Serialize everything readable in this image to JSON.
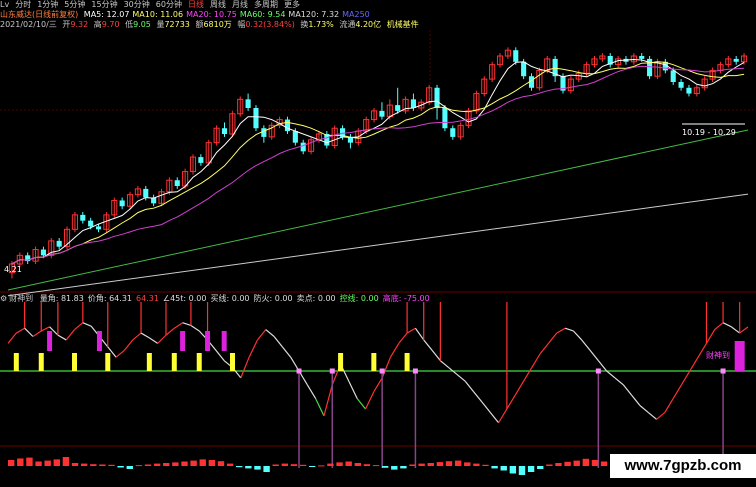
{
  "toolbar": {
    "items": [
      "Lv",
      "分时",
      "1分钟",
      "5分钟",
      "15分钟",
      "30分钟",
      "60分钟",
      "日线",
      "周线",
      "月线",
      "多周期",
      "更多"
    ],
    "active_index": 7
  },
  "info": {
    "title": "山东威达(日线前复权)",
    "ma": [
      {
        "label": "MA5",
        "value": "12.07",
        "color": "#ffffff"
      },
      {
        "label": "MA10",
        "value": "11.06",
        "color": "#ffff66"
      },
      {
        "label": "MA20",
        "value": "10.75",
        "color": "#ff44ff"
      },
      {
        "label": "MA60",
        "value": "9.54",
        "color": "#66ff66"
      },
      {
        "label": "MA120",
        "value": "7.32",
        "color": "#dddddd"
      },
      {
        "label": "MA250",
        "value": "",
        "color": "#6666ff"
      }
    ],
    "date": "2021/02/10/三",
    "open": {
      "label": "开",
      "value": "9.32"
    },
    "high": {
      "label": "高",
      "value": "9.70"
    },
    "low": {
      "label": "低",
      "value": "9.05"
    },
    "volume": {
      "label": "量",
      "value": "72733"
    },
    "amount": {
      "label": "额",
      "value": "6810万"
    },
    "change": {
      "label": "幅",
      "value": "0.32(3.84%)"
    },
    "turnover": {
      "label": "换",
      "value": "1.73%"
    },
    "float": {
      "label": "流通",
      "value": "4.20亿"
    },
    "sector": "机械基件"
  },
  "indicator": {
    "name": "财神到",
    "fields": [
      {
        "label": "量角",
        "value": "81.83",
        "color": "#dddddd"
      },
      {
        "label": "价角",
        "value": "64.31",
        "color": "#dddddd"
      },
      {
        "label": "",
        "value": "64.31",
        "color": "#ff4040"
      },
      {
        "label": "∠45t",
        "value": "0.00",
        "color": "#dddddd"
      },
      {
        "label": "买线",
        "value": "0.00",
        "color": "#dddddd"
      },
      {
        "label": "防火",
        "value": "0.00",
        "color": "#dddddd"
      },
      {
        "label": "卖点",
        "value": "0.00",
        "color": "#dddddd"
      },
      {
        "label": "控线",
        "value": "0.00",
        "color": "#66ff66"
      },
      {
        "label": "高底",
        "value": "-75.00",
        "color": "#ff44ff"
      }
    ]
  },
  "annotations": {
    "low_price": "4.21",
    "range_label": "10.19 - 10.29",
    "signal_label": "财神到"
  },
  "watermark": "www.7gpzb.com",
  "colors": {
    "up": "#ff3232",
    "down": "#54ffff",
    "ma5": "#ffffff",
    "ma10": "#ffff66",
    "ma20": "#d040d0",
    "ma60": "#44bb44",
    "ma120": "#cccccc"
  },
  "chart_data": [
    {
      "type": "candlestick",
      "title": "",
      "ylim": [
        4.0,
        13.0
      ],
      "candles": [
        [
          4.6,
          4.9,
          4.4,
          5.0
        ],
        [
          4.9,
          5.2,
          4.8,
          5.3
        ],
        [
          5.2,
          5.0,
          4.9,
          5.3
        ],
        [
          5.0,
          5.4,
          4.9,
          5.5
        ],
        [
          5.4,
          5.2,
          5.1,
          5.5
        ],
        [
          5.2,
          5.7,
          5.1,
          5.8
        ],
        [
          5.7,
          5.5,
          5.4,
          5.8
        ],
        [
          5.5,
          6.1,
          5.4,
          6.2
        ],
        [
          6.1,
          6.6,
          6.0,
          6.7
        ],
        [
          6.6,
          6.4,
          6.3,
          6.7
        ],
        [
          6.4,
          6.2,
          6.1,
          6.5
        ],
        [
          6.2,
          6.1,
          6.0,
          6.3
        ],
        [
          6.1,
          6.6,
          6.0,
          6.7
        ],
        [
          6.6,
          7.1,
          6.5,
          7.2
        ],
        [
          7.1,
          6.9,
          6.8,
          7.2
        ],
        [
          6.9,
          7.3,
          6.8,
          7.4
        ],
        [
          7.3,
          7.5,
          7.2,
          7.6
        ],
        [
          7.5,
          7.2,
          7.1,
          7.6
        ],
        [
          7.2,
          7.0,
          6.9,
          7.3
        ],
        [
          7.0,
          7.4,
          6.9,
          7.5
        ],
        [
          7.4,
          7.8,
          7.3,
          7.9
        ],
        [
          7.8,
          7.6,
          7.5,
          7.9
        ],
        [
          7.6,
          8.1,
          7.5,
          8.2
        ],
        [
          8.1,
          8.6,
          8.0,
          8.7
        ],
        [
          8.6,
          8.4,
          8.3,
          8.7
        ],
        [
          8.4,
          9.1,
          8.3,
          9.2
        ],
        [
          9.1,
          9.6,
          9.0,
          9.7
        ],
        [
          9.6,
          9.4,
          9.3,
          9.8
        ],
        [
          9.4,
          10.1,
          9.3,
          10.2
        ],
        [
          10.1,
          10.6,
          10.0,
          10.7
        ],
        [
          10.6,
          10.3,
          10.2,
          10.8
        ],
        [
          10.3,
          9.6,
          9.5,
          10.4
        ],
        [
          9.6,
          9.3,
          9.1,
          9.7
        ],
        [
          9.3,
          9.7,
          9.2,
          9.8
        ],
        [
          9.7,
          9.9,
          9.6,
          10.0
        ],
        [
          9.9,
          9.5,
          9.4,
          10.0
        ],
        [
          9.5,
          9.1,
          9.0,
          9.6
        ],
        [
          9.1,
          8.8,
          8.7,
          9.2
        ],
        [
          8.8,
          9.2,
          8.7,
          9.3
        ],
        [
          9.2,
          9.4,
          9.1,
          9.5
        ],
        [
          9.4,
          9.0,
          8.9,
          9.5
        ],
        [
          9.0,
          9.6,
          8.9,
          9.7
        ],
        [
          9.6,
          9.3,
          9.2,
          9.7
        ],
        [
          9.3,
          9.1,
          8.9,
          9.4
        ],
        [
          9.1,
          9.5,
          9.0,
          9.6
        ],
        [
          9.5,
          9.9,
          9.4,
          10.0
        ],
        [
          9.9,
          10.2,
          9.8,
          10.3
        ],
        [
          10.2,
          10.0,
          9.9,
          10.5
        ],
        [
          10.0,
          10.4,
          9.9,
          10.6
        ],
        [
          10.4,
          10.2,
          10.1,
          11.0
        ],
        [
          10.2,
          10.6,
          10.1,
          10.7
        ],
        [
          10.6,
          10.3,
          10.2,
          10.8
        ],
        [
          10.3,
          10.5,
          10.2,
          10.6
        ],
        [
          10.5,
          11.0,
          10.4,
          11.1
        ],
        [
          11.0,
          10.3,
          9.9,
          11.1
        ],
        [
          10.3,
          9.6,
          9.5,
          10.4
        ],
        [
          9.6,
          9.3,
          9.2,
          9.7
        ],
        [
          9.3,
          9.7,
          9.2,
          9.8
        ],
        [
          9.7,
          10.2,
          9.6,
          10.3
        ],
        [
          10.2,
          10.8,
          10.1,
          10.9
        ],
        [
          10.8,
          11.3,
          10.7,
          11.4
        ],
        [
          11.3,
          11.8,
          11.2,
          11.9
        ],
        [
          11.8,
          12.1,
          11.7,
          12.2
        ],
        [
          12.1,
          12.3,
          12.0,
          12.4
        ],
        [
          12.3,
          11.9,
          11.8,
          12.4
        ],
        [
          11.9,
          11.4,
          11.3,
          12.0
        ],
        [
          11.4,
          11.0,
          10.9,
          11.5
        ],
        [
          11.0,
          11.6,
          10.9,
          11.7
        ],
        [
          11.6,
          12.0,
          11.5,
          12.1
        ],
        [
          12.0,
          11.4,
          11.2,
          12.1
        ],
        [
          11.4,
          10.9,
          10.8,
          11.5
        ],
        [
          10.9,
          11.3,
          10.8,
          11.4
        ],
        [
          11.3,
          11.5,
          11.2,
          11.6
        ],
        [
          11.5,
          11.8,
          11.4,
          11.9
        ],
        [
          11.8,
          12.0,
          11.7,
          12.1
        ],
        [
          12.0,
          12.1,
          11.9,
          12.2
        ],
        [
          12.1,
          11.8,
          11.7,
          12.2
        ],
        [
          11.8,
          12.0,
          11.7,
          12.1
        ],
        [
          12.0,
          11.9,
          11.8,
          12.1
        ],
        [
          11.9,
          12.1,
          11.8,
          12.2
        ],
        [
          12.1,
          12.0,
          11.9,
          12.2
        ],
        [
          12.0,
          11.4,
          11.3,
          12.1
        ],
        [
          11.4,
          11.9,
          11.3,
          12.0
        ],
        [
          11.9,
          11.6,
          11.5,
          12.0
        ],
        [
          11.6,
          11.2,
          11.1,
          11.7
        ],
        [
          11.2,
          11.0,
          10.9,
          11.3
        ],
        [
          11.0,
          10.8,
          10.7,
          11.1
        ],
        [
          10.8,
          11.0,
          10.7,
          11.1
        ],
        [
          11.0,
          11.3,
          10.9,
          11.4
        ],
        [
          11.3,
          11.6,
          11.2,
          11.7
        ],
        [
          11.6,
          11.8,
          11.5,
          11.9
        ],
        [
          11.8,
          12.0,
          11.7,
          12.1
        ],
        [
          12.0,
          11.9,
          11.8,
          12.1
        ],
        [
          11.9,
          12.1,
          11.8,
          12.2
        ]
      ],
      "series": [
        {
          "name": "MA5",
          "values": []
        },
        {
          "name": "MA10",
          "values": []
        },
        {
          "name": "MA20",
          "values": []
        },
        {
          "name": "MA60",
          "values": [
            4.0,
            9.54
          ]
        },
        {
          "name": "MA120",
          "values": [
            3.8,
            7.32
          ]
        }
      ]
    },
    {
      "type": "line",
      "title": "",
      "ylim": [
        -100,
        100
      ],
      "series": [
        {
          "name": "价角",
          "values": [
            40,
            55,
            62,
            50,
            58,
            64,
            52,
            45,
            60,
            70,
            65,
            50,
            35,
            20,
            30,
            45,
            55,
            48,
            40,
            52,
            62,
            70,
            66,
            58,
            45,
            30,
            15,
            5,
            -10,
            20,
            45,
            60,
            50,
            35,
            20,
            0,
            -20,
            -40,
            -65,
            -20,
            10,
            -15,
            -40,
            -55,
            -30,
            -10,
            20,
            40,
            55,
            62,
            45,
            30,
            15,
            5,
            -5,
            -15,
            -30,
            -45,
            -60,
            -75,
            -55,
            -35,
            -15,
            5,
            25,
            40,
            55,
            62,
            58,
            45,
            30,
            15,
            0,
            -10,
            -20,
            -35,
            -50,
            -60,
            -70,
            -60,
            -40,
            -20,
            0,
            20,
            40,
            60,
            70,
            64,
            55,
            64
          ]
        }
      ]
    },
    {
      "type": "bar",
      "title": "",
      "ylim": [
        -4,
        6
      ],
      "values": [
        2.0,
        2.5,
        2.8,
        1.5,
        1.8,
        2.2,
        3.0,
        1.0,
        0.8,
        0.6,
        0.5,
        0.4,
        -0.5,
        -1.0,
        0.3,
        0.5,
        0.8,
        1.0,
        1.2,
        1.5,
        1.8,
        2.2,
        2.0,
        1.6,
        0.8,
        -0.4,
        -0.8,
        -1.2,
        -2.0,
        0.5,
        0.8,
        0.6,
        0.4,
        -0.3,
        0.2,
        0.8,
        1.2,
        1.5,
        1.0,
        0.6,
        0.3,
        -0.6,
        -1.2,
        -0.8,
        0.5,
        0.8,
        1.0,
        1.3,
        1.6,
        1.8,
        1.2,
        0.8,
        0.4,
        -0.8,
        -1.5,
        -2.5,
        -3.0,
        -2.0,
        -1.0,
        0.5,
        1.0,
        1.4,
        1.8,
        2.4,
        2.0,
        1.5
      ]
    }
  ]
}
